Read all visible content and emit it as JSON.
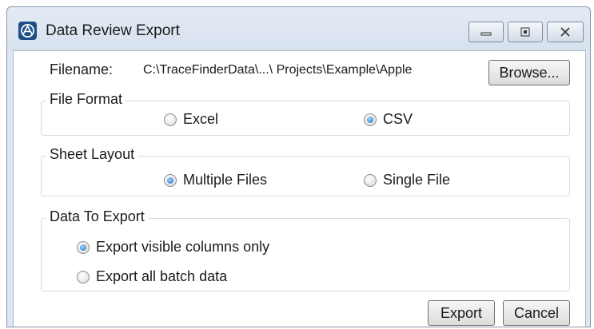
{
  "window": {
    "title": "Data Review Export",
    "controls": [
      "minimize",
      "maximize",
      "close"
    ]
  },
  "filename": {
    "label": "Filename:",
    "value": "C:\\TraceFinderData\\...\\ Projects\\Example\\Apple",
    "browse_label": "Browse..."
  },
  "file_format": {
    "legend": "File Format",
    "options": [
      {
        "label": "Excel",
        "selected": false
      },
      {
        "label": "CSV",
        "selected": true
      }
    ]
  },
  "sheet_layout": {
    "legend": "Sheet Layout",
    "options": [
      {
        "label": "Multiple Files",
        "selected": true
      },
      {
        "label": "Single File",
        "selected": false
      }
    ]
  },
  "data_to_export": {
    "legend": "Data To Export",
    "options": [
      {
        "label": "Export visible columns only",
        "selected": true
      },
      {
        "label": "Export all batch data",
        "selected": false
      }
    ]
  },
  "footer": {
    "export_label": "Export",
    "cancel_label": "Cancel"
  },
  "colors": {
    "radio_selected": "#1b72c4",
    "window_frame": "#dde6f1",
    "app_icon": "#1d4f86"
  }
}
